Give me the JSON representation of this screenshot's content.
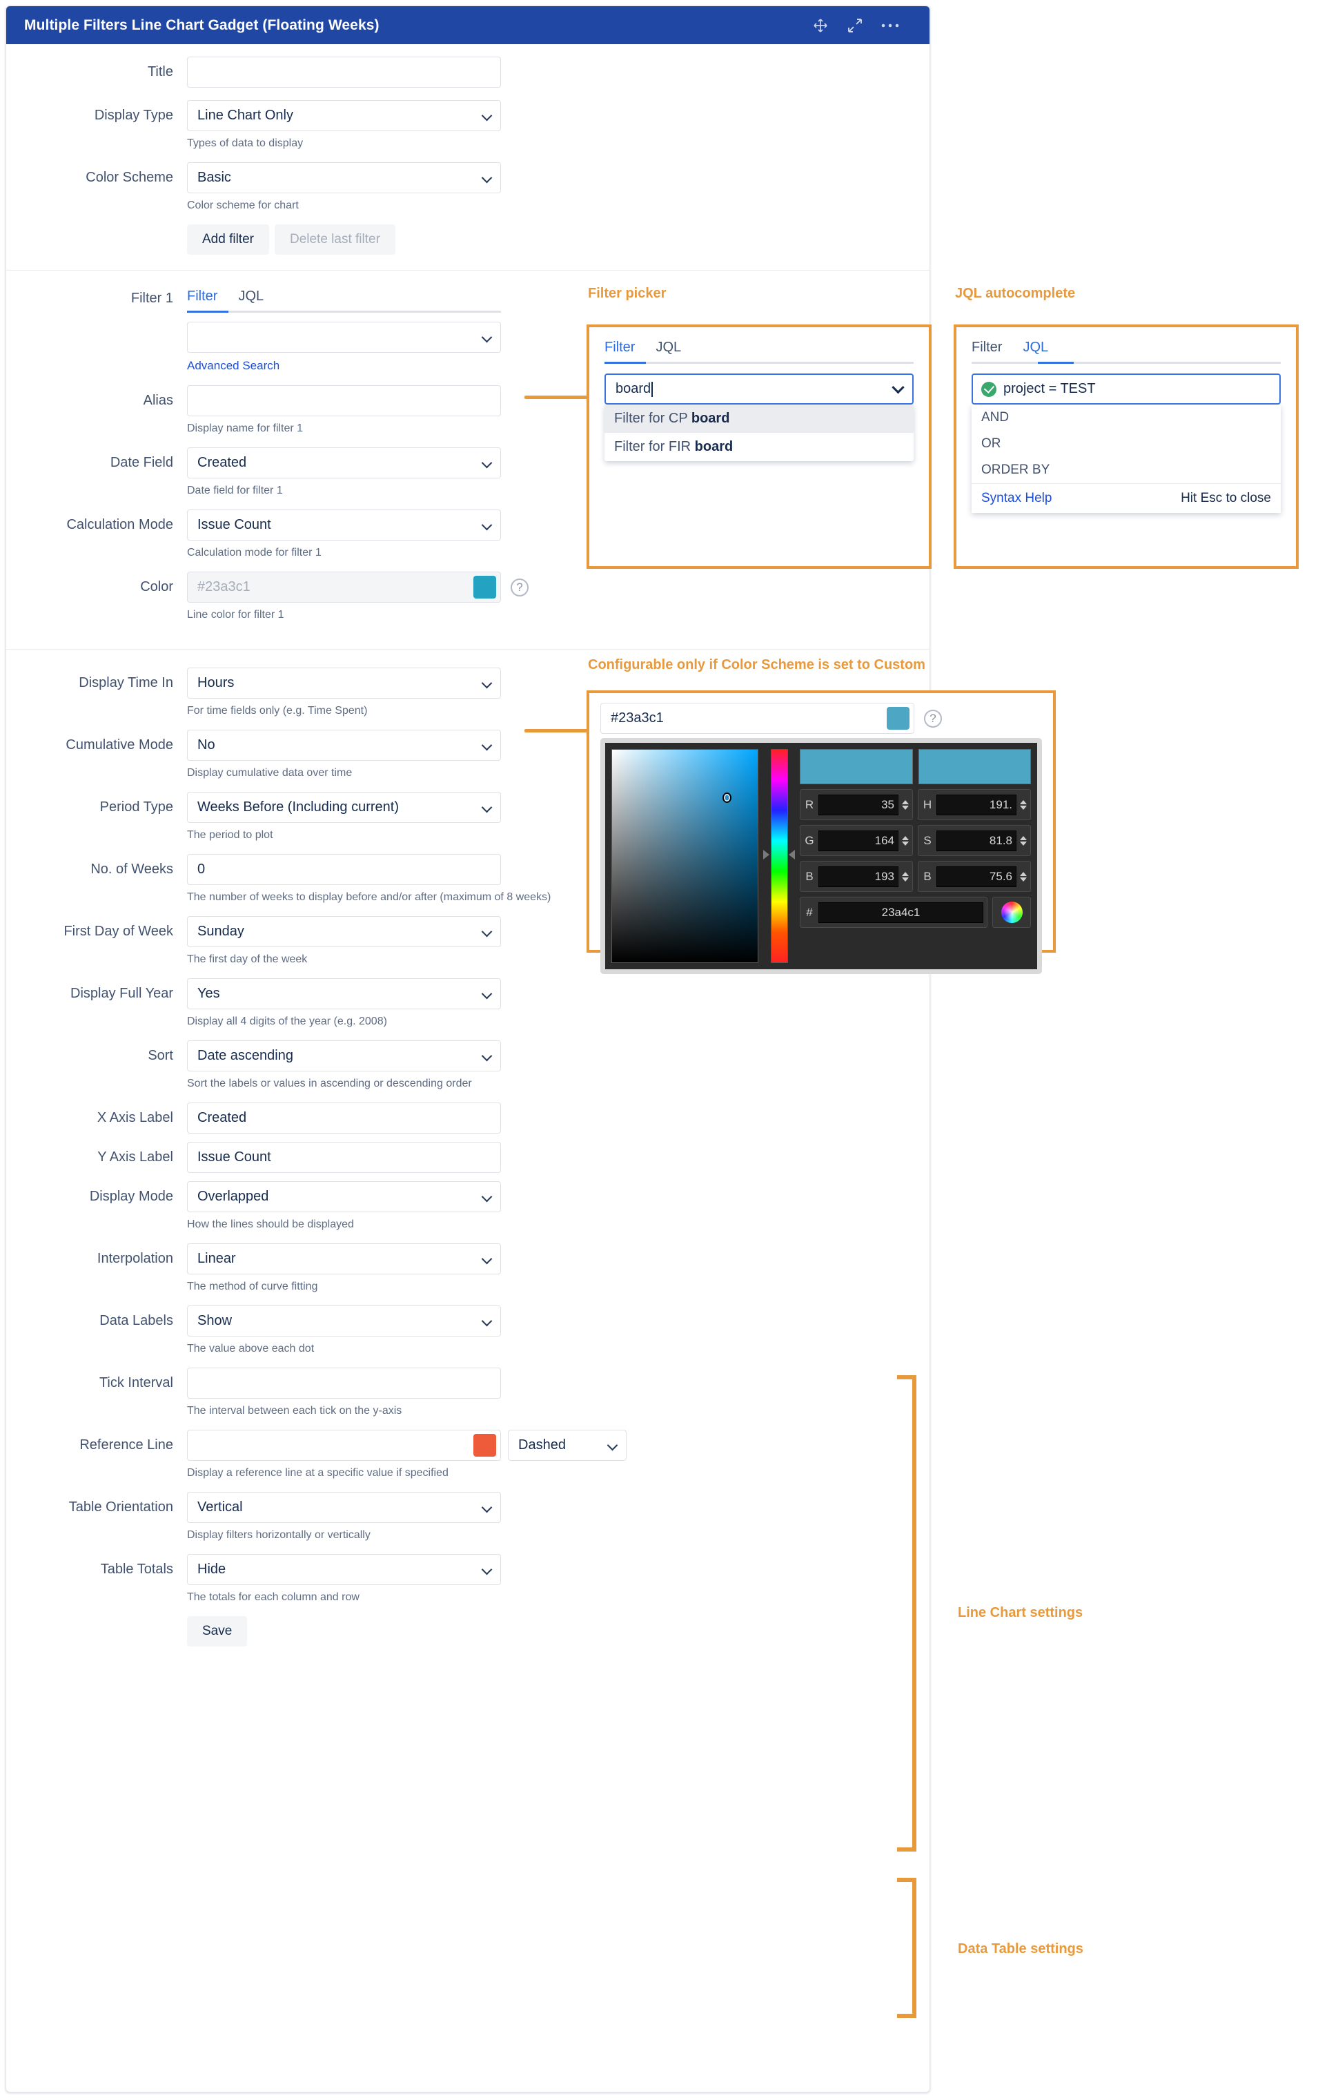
{
  "window": {
    "title": "Multiple Filters Line Chart Gadget (Floating Weeks)",
    "icons": [
      "move-icon",
      "expand-icon",
      "more-options-icon"
    ]
  },
  "colors": {
    "accent_annotation": "#e8993b",
    "titlebar": "#1f47a3",
    "link": "#1c4fd8",
    "filter_color_swatch": "#23a3c1",
    "reference_line_swatch": "#ee5b3a"
  },
  "form": {
    "title": {
      "label": "Title",
      "value": "",
      "placeholder": ""
    },
    "display_type": {
      "label": "Display Type",
      "value": "Line Chart Only",
      "hint": "Types of data to display"
    },
    "color_scheme": {
      "label": "Color Scheme",
      "value": "Basic",
      "hint": "Color scheme for chart"
    },
    "buttons": {
      "add_filter": "Add filter",
      "delete_last_filter": "Delete last filter"
    },
    "filter1": {
      "label": "Filter 1",
      "tabs": [
        "Filter",
        "JQL"
      ],
      "active_tab": "Filter",
      "picker_value": "",
      "advanced_search": "Advanced Search"
    },
    "alias": {
      "label": "Alias",
      "value": "",
      "hint": "Display name for filter 1"
    },
    "date_field": {
      "label": "Date Field",
      "value": "Created",
      "hint": "Date field for filter 1"
    },
    "calculation_mode": {
      "label": "Calculation Mode",
      "value": "Issue Count",
      "hint": "Calculation mode for filter 1"
    },
    "color": {
      "label": "Color",
      "value": "",
      "placeholder": "#23a3c1",
      "hint": "Line color for filter 1"
    },
    "display_time_in": {
      "label": "Display Time In",
      "value": "Hours",
      "hint": "For time fields only (e.g. Time Spent)"
    },
    "cumulative_mode": {
      "label": "Cumulative Mode",
      "value": "No",
      "hint": "Display cumulative data over time"
    },
    "period_type": {
      "label": "Period Type",
      "value": "Weeks Before (Including current)",
      "hint": "The period to plot"
    },
    "no_of_weeks": {
      "label": "No. of Weeks",
      "value": "0",
      "hint": "The number of weeks to display before and/or after (maximum of 8 weeks)"
    },
    "first_day_of_week": {
      "label": "First Day of Week",
      "value": "Sunday",
      "hint": "The first day of the week"
    },
    "display_full_year": {
      "label": "Display Full Year",
      "value": "Yes",
      "hint": "Display all 4 digits of the year (e.g. 2008)"
    },
    "sort": {
      "label": "Sort",
      "value": "Date ascending",
      "hint": "Sort the labels or values in ascending or descending order"
    },
    "x_axis_label": {
      "label": "X Axis Label",
      "value": "Created"
    },
    "y_axis_label": {
      "label": "Y Axis Label",
      "value": "Issue Count"
    },
    "display_mode": {
      "label": "Display Mode",
      "value": "Overlapped",
      "hint": "How the lines should be displayed"
    },
    "interpolation": {
      "label": "Interpolation",
      "value": "Linear",
      "hint": "The method of curve fitting"
    },
    "data_labels": {
      "label": "Data Labels",
      "value": "Show",
      "hint": "The value above each dot"
    },
    "tick_interval": {
      "label": "Tick Interval",
      "value": "",
      "hint": "The interval between each tick on the y-axis"
    },
    "reference_line": {
      "label": "Reference Line",
      "value": "",
      "style": "Dashed",
      "hint": "Display a reference line at a specific value if specified"
    },
    "table_orientation": {
      "label": "Table Orientation",
      "value": "Vertical",
      "hint": "Display filters horizontally or vertically"
    },
    "table_totals": {
      "label": "Table Totals",
      "value": "Hide",
      "hint": "The totals for each column and row"
    },
    "save": "Save"
  },
  "callouts": {
    "filter_picker": {
      "title": "Filter picker",
      "tabs": [
        "Filter",
        "JQL"
      ],
      "active_tab": "Filter",
      "input_value": "board",
      "suggestions": [
        {
          "prefix": "Filter for CP ",
          "match": "board",
          "highlighted": true
        },
        {
          "prefix": "Filter for FIR ",
          "match": "board",
          "highlighted": false
        }
      ]
    },
    "jql_autocomplete": {
      "title": "JQL autocomplete",
      "tabs": [
        "Filter",
        "JQL"
      ],
      "active_tab": "JQL",
      "input_value": "project = TEST",
      "valid": true,
      "options": [
        "AND",
        "OR",
        "ORDER BY"
      ],
      "footer_link": "Syntax Help",
      "footer_hint": "Hit Esc to close"
    },
    "color_picker": {
      "title": "Configurable only if Color Scheme is set to Custom",
      "hex_field_value": "#23a3c1",
      "swatch": "#23a3c1",
      "preview_old": "#4da6c3",
      "preview_new": "#4da6c3",
      "channels": [
        {
          "key": "R",
          "value": "35"
        },
        {
          "key": "H",
          "value": "191."
        },
        {
          "key": "G",
          "value": "164"
        },
        {
          "key": "S",
          "value": "81.8"
        },
        {
          "key": "B",
          "value": "193"
        },
        {
          "key": "B",
          "value": "75.6"
        }
      ],
      "hex_key": "#",
      "hex_value": "23a4c1"
    },
    "line_chart_settings": "Line Chart settings",
    "data_table_settings": "Data Table settings"
  }
}
